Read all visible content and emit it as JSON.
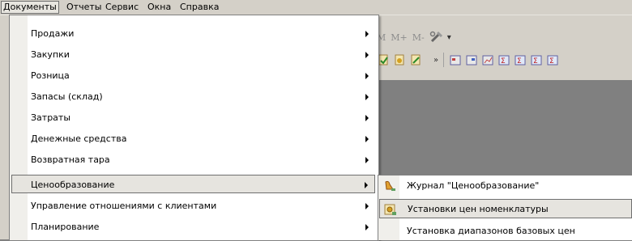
{
  "menubar": {
    "items": [
      {
        "label": "Документы"
      },
      {
        "label": "Отчеты"
      },
      {
        "label": "Сервис"
      },
      {
        "label": "Окна"
      },
      {
        "label": "Справка"
      }
    ]
  },
  "toolbar": {
    "memory_buttons": [
      "M",
      "M+",
      "M-"
    ]
  },
  "documents_menu": {
    "items": [
      {
        "label": "Продажи"
      },
      {
        "label": "Закупки"
      },
      {
        "label": "Розница"
      },
      {
        "label": "Запасы (склад)"
      },
      {
        "label": "Затраты"
      },
      {
        "label": "Денежные средства"
      },
      {
        "label": "Возвратная тара"
      },
      {
        "label": "Ценообразование"
      },
      {
        "label": "Управление отношениями с клиентами"
      },
      {
        "label": "Планирование"
      }
    ]
  },
  "pricing_submenu": {
    "items": [
      {
        "label": "Журнал \"Ценообразование\"",
        "icon": "journal-icon"
      },
      {
        "label": "Установки цен номенклатуры",
        "icon": "price-settings-icon"
      },
      {
        "label": "Установка диапазонов базовых цен",
        "icon": ""
      }
    ]
  },
  "colors": {
    "menu_bg": "#ffffff",
    "gutter": "#f0efeb",
    "highlight": "#e6e4df",
    "chrome": "#d4d0c8",
    "workspace": "#808080"
  }
}
